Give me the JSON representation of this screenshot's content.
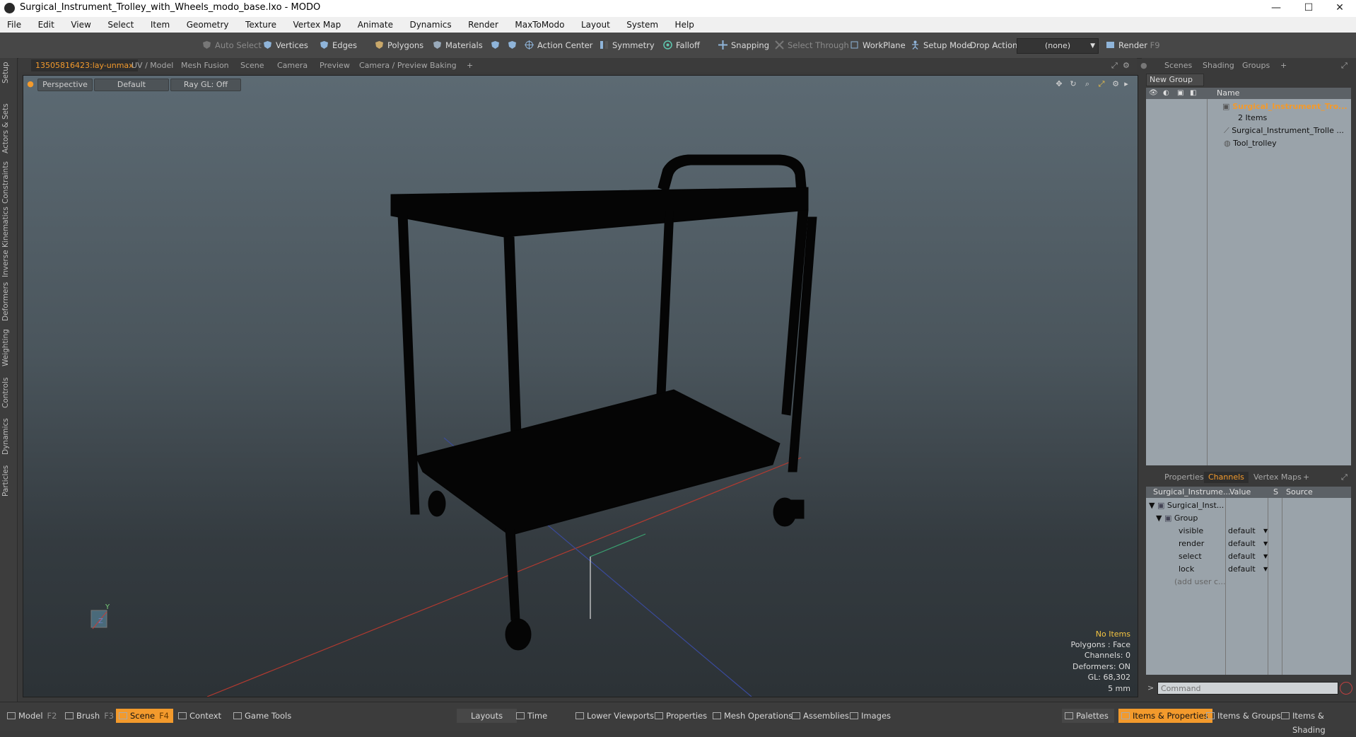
{
  "window": {
    "title": "Surgical_Instrument_Trolley_with_Wheels_modo_base.lxo - MODO",
    "min": "—",
    "max": "☐",
    "close": "✕"
  },
  "menu": [
    "File",
    "Edit",
    "View",
    "Select",
    "Item",
    "Geometry",
    "Texture",
    "Vertex Map",
    "Animate",
    "Dynamics",
    "Render",
    "MaxToModo",
    "Layout",
    "System",
    "Help"
  ],
  "toolbar": {
    "auto_select": "Auto Select",
    "vertices": "Vertices",
    "edges": "Edges",
    "polygons": "Polygons",
    "materials": "Materials",
    "action_center": "Action Center",
    "symmetry": "Symmetry",
    "falloff": "Falloff",
    "snapping": "Snapping",
    "select_through": "Select Through",
    "workplane": "WorkPlane",
    "setup_mode": "Setup Mode",
    "drop_action": "Drop Action",
    "drop_value": "(none)",
    "render": "Render",
    "render_key": "F9"
  },
  "left_tabs": [
    "Setup",
    "Actors & Sets",
    "Constraints",
    "Inverse Kinematics",
    "Deformers",
    "Weighting",
    "Controls",
    "Dynamics",
    "Particles"
  ],
  "viewport_tabs": [
    "13505816423:lay-unmax",
    "UV / Model",
    "Mesh Fusion",
    "Scene",
    "Camera",
    "Preview",
    "Camera / Preview",
    "Baking",
    "+"
  ],
  "viewport": {
    "perspective": "Perspective",
    "default": "Default",
    "raygl": "Ray GL: Off",
    "axis_y": "Y",
    "axis_z": "Z",
    "info": {
      "no_items": "No Items",
      "polygons": "Polygons : Face",
      "channels": "Channels: 0",
      "deformers": "Deformers: ON",
      "gl": "GL: 68,302",
      "unit": "5 mm"
    }
  },
  "groups_panel": {
    "tabs": [
      "Scenes",
      "Shading",
      "Groups",
      "+"
    ],
    "new_group": "New Group",
    "name_col": "Name",
    "group_name": "Surgical_Instrument_Tro...",
    "item_count": "2 Items",
    "children": [
      "Surgical_Instrument_Trolle ...",
      "Tool_trolley"
    ]
  },
  "channels_panel": {
    "tabs": [
      "Properties",
      "Channels",
      "Vertex Maps",
      "+"
    ],
    "col_name": "Surgical_Instrume...",
    "col_value": "Value",
    "col_s": "S",
    "col_source": "Source",
    "root": "Surgical_Inst...",
    "group": "Group",
    "rows": [
      {
        "name": "visible",
        "value": "default"
      },
      {
        "name": "render",
        "value": "default"
      },
      {
        "name": "select",
        "value": "default"
      },
      {
        "name": "lock",
        "value": "default"
      }
    ],
    "add_user": "(add user c...",
    "command_placeholder": "Command",
    "prompt": ">"
  },
  "bottom_bar": {
    "model": "Model",
    "model_key": "F2",
    "brush": "Brush",
    "brush_key": "F3",
    "scene": "Scene",
    "scene_key": "F4",
    "context": "Context",
    "game_tools": "Game Tools",
    "layouts": "Layouts",
    "time": "Time",
    "lower_viewports": "Lower Viewports",
    "properties": "Properties",
    "mesh_operations": "Mesh Operations",
    "assemblies": "Assemblies",
    "images": "Images",
    "palettes": "Palettes",
    "items_properties": "Items & Properties",
    "items_groups": "Items & Groups",
    "items_shading": "Items & Shading"
  },
  "colors": {
    "accent": "#f39a2c",
    "highlight": "#f5c542"
  }
}
